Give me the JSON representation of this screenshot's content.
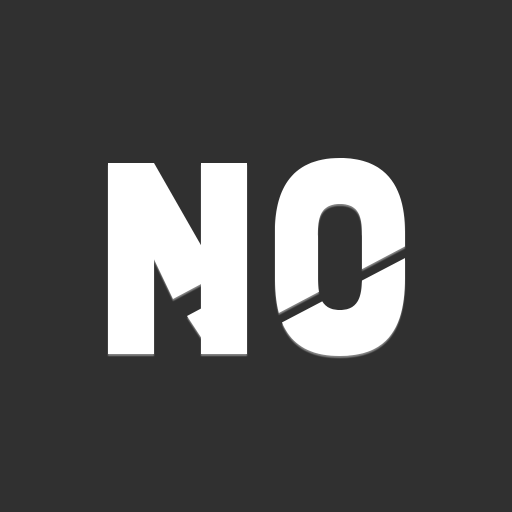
{
  "logo": {
    "icon": "no-logo-icon",
    "text": "NO"
  },
  "colors": {
    "background": "#303030",
    "foreground": "#ffffff",
    "shadow": "#8a8a8a"
  }
}
